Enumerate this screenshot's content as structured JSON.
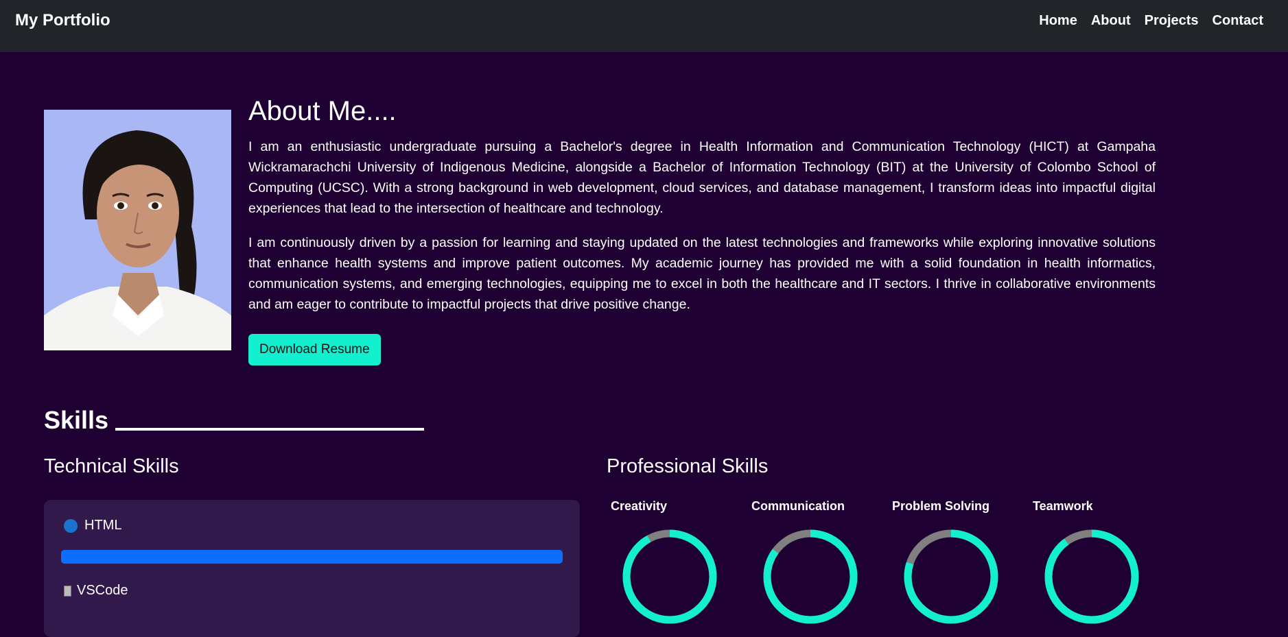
{
  "navbar": {
    "brand": "My Portfolio",
    "links": [
      "Home",
      "About",
      "Projects",
      "Contact"
    ]
  },
  "about": {
    "title": "About Me....",
    "paragraphs": [
      "I am an enthusiastic undergraduate pursuing a Bachelor's degree in Health Information and Communication Technology (HICT) at Gampaha Wickramarachchi University of Indigenous Medicine, alongside a Bachelor of Information Technology (BIT) at the University of Colombo School of Computing (UCSC). With a strong background in web development, cloud services, and database management, I transform ideas into impactful digital experiences that lead to the intersection of healthcare and technology.",
      "I am continuously driven by a passion for learning and staying updated on the latest technologies and frameworks while exploring innovative solutions that enhance health systems and improve patient outcomes. My academic journey has provided me with a solid foundation in health informatics, communication systems, and emerging technologies, equipping me to excel in both the healthcare and IT sectors. I thrive in collaborative environments and am eager to contribute to impactful projects that drive positive change."
    ],
    "resume_button": "Download Resume"
  },
  "skills": {
    "heading": "Skills",
    "technical_title": "Technical Skills",
    "professional_title": "Professional Skills",
    "technical": [
      {
        "name": "HTML",
        "level": 1.0,
        "icon": "html-icon"
      },
      {
        "name": "VSCode",
        "icon": "vscode-icon"
      }
    ],
    "professional": [
      {
        "name": "Creativity",
        "level": 0.92
      },
      {
        "name": "Communication",
        "level": 0.85
      },
      {
        "name": "Problem Solving",
        "level": 0.8
      },
      {
        "name": "Teamwork",
        "level": 0.9
      }
    ]
  },
  "colors": {
    "page_bg": "#1e0033",
    "navbar_bg": "#212529",
    "accent": "#12f0d0",
    "bar_fill": "#0d6efd",
    "ring_track": "#808080"
  }
}
